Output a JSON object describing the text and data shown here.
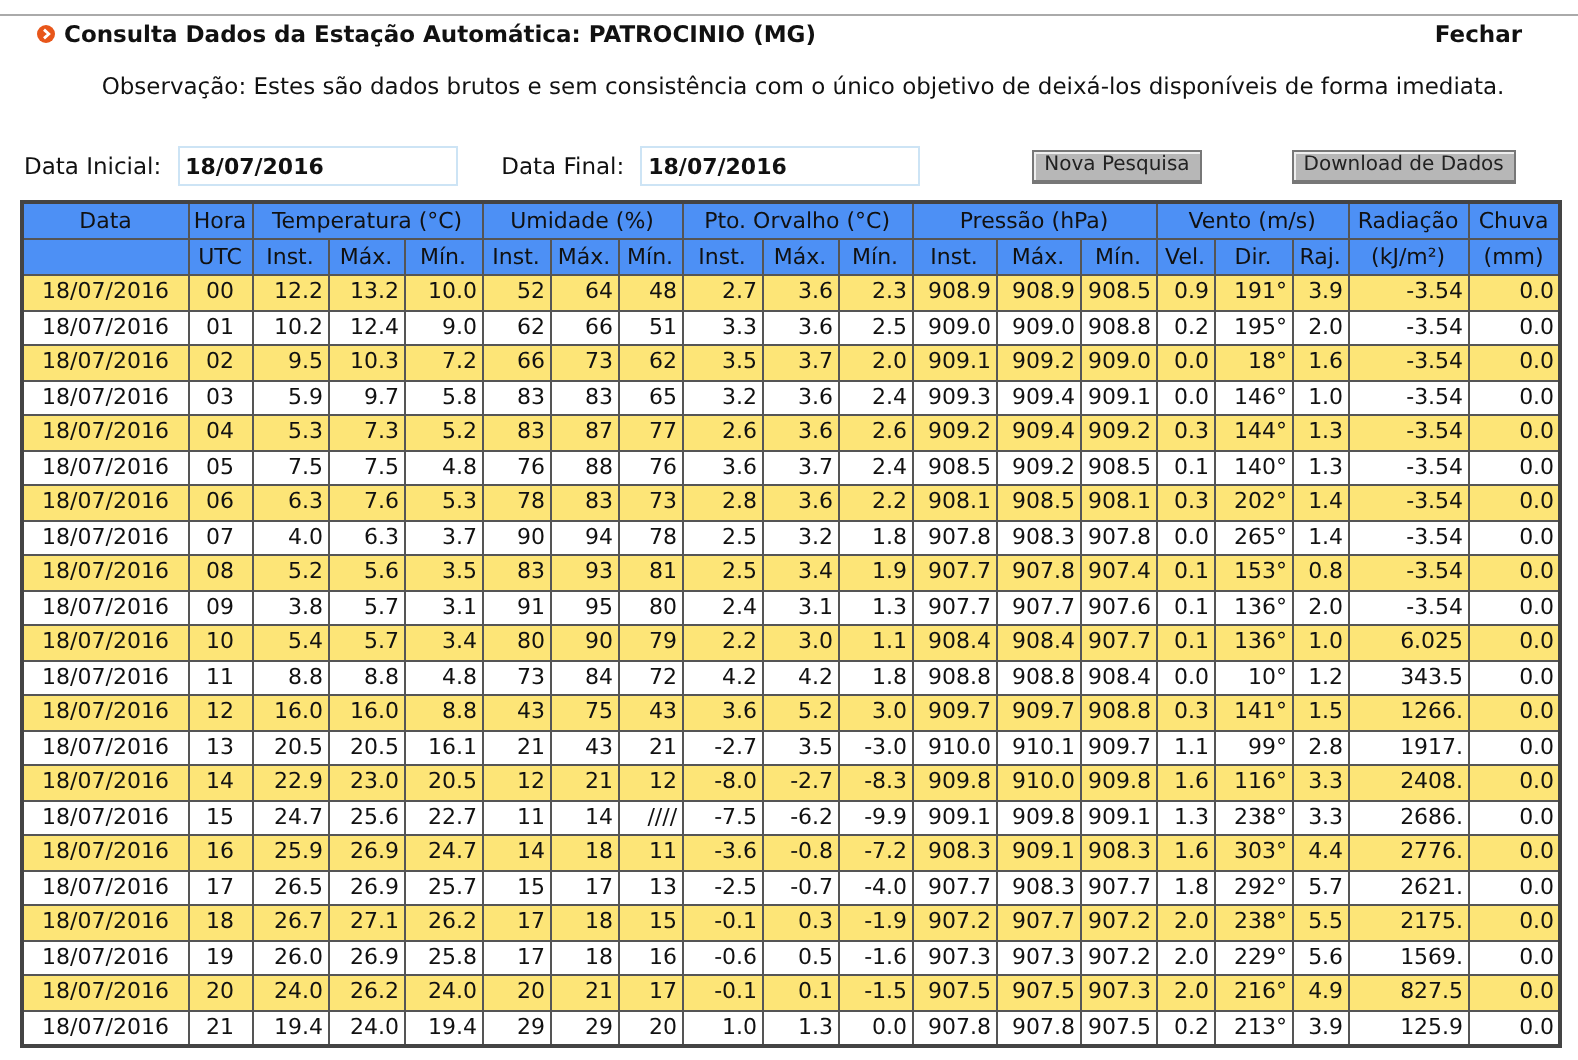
{
  "title": "Consulta Dados da Estação Automática: PATROCINIO (MG)",
  "close_link": "Fechar",
  "note": "Observação: Estes são dados brutos e sem consistência com o único objetivo de deixá-los disponíveis de forma imediata.",
  "form": {
    "start_label": "Data Inicial:",
    "start_value": "18/07/2016",
    "end_label": "Data Final:",
    "end_value": "18/07/2016",
    "buttons": [
      "Nova Pesquisa",
      "Download de Dados"
    ]
  },
  "table": {
    "column_groups": [
      {
        "label": "Data",
        "columns": [
          ""
        ]
      },
      {
        "label": "Hora",
        "columns": [
          "UTC"
        ]
      },
      {
        "label": "Temperatura (°C)",
        "columns": [
          "Inst.",
          "Máx.",
          "Mín."
        ]
      },
      {
        "label": "Umidade (%)",
        "columns": [
          "Inst.",
          "Máx.",
          "Mín."
        ]
      },
      {
        "label": "Pto. Orvalho (°C)",
        "columns": [
          "Inst.",
          "Máx.",
          "Mín."
        ]
      },
      {
        "label": "Pressão (hPa)",
        "columns": [
          "Inst.",
          "Máx.",
          "Mín."
        ]
      },
      {
        "label": "Vento (m/s)",
        "columns": [
          "Vel.",
          "Dir.",
          "Raj."
        ]
      },
      {
        "label": "Radiação",
        "columns": [
          "(kJ/m²)"
        ]
      },
      {
        "label": "Chuva",
        "columns": [
          "(mm)"
        ]
      }
    ],
    "rows": [
      [
        "18/07/2016",
        "00",
        "12.2",
        "13.2",
        "10.0",
        "52",
        "64",
        "48",
        "2.7",
        "3.6",
        "2.3",
        "908.9",
        "908.9",
        "908.5",
        "0.9",
        "191°",
        "3.9",
        "-3.54",
        "0.0"
      ],
      [
        "18/07/2016",
        "01",
        "10.2",
        "12.4",
        "9.0",
        "62",
        "66",
        "51",
        "3.3",
        "3.6",
        "2.5",
        "909.0",
        "909.0",
        "908.8",
        "0.2",
        "195°",
        "2.0",
        "-3.54",
        "0.0"
      ],
      [
        "18/07/2016",
        "02",
        "9.5",
        "10.3",
        "7.2",
        "66",
        "73",
        "62",
        "3.5",
        "3.7",
        "2.0",
        "909.1",
        "909.2",
        "909.0",
        "0.0",
        "18°",
        "1.6",
        "-3.54",
        "0.0"
      ],
      [
        "18/07/2016",
        "03",
        "5.9",
        "9.7",
        "5.8",
        "83",
        "83",
        "65",
        "3.2",
        "3.6",
        "2.4",
        "909.3",
        "909.4",
        "909.1",
        "0.0",
        "146°",
        "1.0",
        "-3.54",
        "0.0"
      ],
      [
        "18/07/2016",
        "04",
        "5.3",
        "7.3",
        "5.2",
        "83",
        "87",
        "77",
        "2.6",
        "3.6",
        "2.6",
        "909.2",
        "909.4",
        "909.2",
        "0.3",
        "144°",
        "1.3",
        "-3.54",
        "0.0"
      ],
      [
        "18/07/2016",
        "05",
        "7.5",
        "7.5",
        "4.8",
        "76",
        "88",
        "76",
        "3.6",
        "3.7",
        "2.4",
        "908.5",
        "909.2",
        "908.5",
        "0.1",
        "140°",
        "1.3",
        "-3.54",
        "0.0"
      ],
      [
        "18/07/2016",
        "06",
        "6.3",
        "7.6",
        "5.3",
        "78",
        "83",
        "73",
        "2.8",
        "3.6",
        "2.2",
        "908.1",
        "908.5",
        "908.1",
        "0.3",
        "202°",
        "1.4",
        "-3.54",
        "0.0"
      ],
      [
        "18/07/2016",
        "07",
        "4.0",
        "6.3",
        "3.7",
        "90",
        "94",
        "78",
        "2.5",
        "3.2",
        "1.8",
        "907.8",
        "908.3",
        "907.8",
        "0.0",
        "265°",
        "1.4",
        "-3.54",
        "0.0"
      ],
      [
        "18/07/2016",
        "08",
        "5.2",
        "5.6",
        "3.5",
        "83",
        "93",
        "81",
        "2.5",
        "3.4",
        "1.9",
        "907.7",
        "907.8",
        "907.4",
        "0.1",
        "153°",
        "0.8",
        "-3.54",
        "0.0"
      ],
      [
        "18/07/2016",
        "09",
        "3.8",
        "5.7",
        "3.1",
        "91",
        "95",
        "80",
        "2.4",
        "3.1",
        "1.3",
        "907.7",
        "907.7",
        "907.6",
        "0.1",
        "136°",
        "2.0",
        "-3.54",
        "0.0"
      ],
      [
        "18/07/2016",
        "10",
        "5.4",
        "5.7",
        "3.4",
        "80",
        "90",
        "79",
        "2.2",
        "3.0",
        "1.1",
        "908.4",
        "908.4",
        "907.7",
        "0.1",
        "136°",
        "1.0",
        "6.025",
        "0.0"
      ],
      [
        "18/07/2016",
        "11",
        "8.8",
        "8.8",
        "4.8",
        "73",
        "84",
        "72",
        "4.2",
        "4.2",
        "1.8",
        "908.8",
        "908.8",
        "908.4",
        "0.0",
        "10°",
        "1.2",
        "343.5",
        "0.0"
      ],
      [
        "18/07/2016",
        "12",
        "16.0",
        "16.0",
        "8.8",
        "43",
        "75",
        "43",
        "3.6",
        "5.2",
        "3.0",
        "909.7",
        "909.7",
        "908.8",
        "0.3",
        "141°",
        "1.5",
        "1266.",
        "0.0"
      ],
      [
        "18/07/2016",
        "13",
        "20.5",
        "20.5",
        "16.1",
        "21",
        "43",
        "21",
        "-2.7",
        "3.5",
        "-3.0",
        "910.0",
        "910.1",
        "909.7",
        "1.1",
        "99°",
        "2.8",
        "1917.",
        "0.0"
      ],
      [
        "18/07/2016",
        "14",
        "22.9",
        "23.0",
        "20.5",
        "12",
        "21",
        "12",
        "-8.0",
        "-2.7",
        "-8.3",
        "909.8",
        "910.0",
        "909.8",
        "1.6",
        "116°",
        "3.3",
        "2408.",
        "0.0"
      ],
      [
        "18/07/2016",
        "15",
        "24.7",
        "25.6",
        "22.7",
        "11",
        "14",
        "////",
        "-7.5",
        "-6.2",
        "-9.9",
        "909.1",
        "909.8",
        "909.1",
        "1.3",
        "238°",
        "3.3",
        "2686.",
        "0.0"
      ],
      [
        "18/07/2016",
        "16",
        "25.9",
        "26.9",
        "24.7",
        "14",
        "18",
        "11",
        "-3.6",
        "-0.8",
        "-7.2",
        "908.3",
        "909.1",
        "908.3",
        "1.6",
        "303°",
        "4.4",
        "2776.",
        "0.0"
      ],
      [
        "18/07/2016",
        "17",
        "26.5",
        "26.9",
        "25.7",
        "15",
        "17",
        "13",
        "-2.5",
        "-0.7",
        "-4.0",
        "907.7",
        "908.3",
        "907.7",
        "1.8",
        "292°",
        "5.7",
        "2621.",
        "0.0"
      ],
      [
        "18/07/2016",
        "18",
        "26.7",
        "27.1",
        "26.2",
        "17",
        "18",
        "15",
        "-0.1",
        "0.3",
        "-1.9",
        "907.2",
        "907.7",
        "907.2",
        "2.0",
        "238°",
        "5.5",
        "2175.",
        "0.0"
      ],
      [
        "18/07/2016",
        "19",
        "26.0",
        "26.9",
        "25.8",
        "17",
        "18",
        "16",
        "-0.6",
        "0.5",
        "-1.6",
        "907.3",
        "907.3",
        "907.2",
        "2.0",
        "229°",
        "5.6",
        "1569.",
        "0.0"
      ],
      [
        "18/07/2016",
        "20",
        "24.0",
        "26.2",
        "24.0",
        "20",
        "21",
        "17",
        "-0.1",
        "0.1",
        "-1.5",
        "907.5",
        "907.5",
        "907.3",
        "2.0",
        "216°",
        "4.9",
        "827.5",
        "0.0"
      ],
      [
        "18/07/2016",
        "21",
        "19.4",
        "24.0",
        "19.4",
        "29",
        "29",
        "20",
        "1.0",
        "1.3",
        "0.0",
        "907.8",
        "907.8",
        "907.5",
        "0.2",
        "213°",
        "3.9",
        "125.9",
        "0.0"
      ]
    ]
  }
}
